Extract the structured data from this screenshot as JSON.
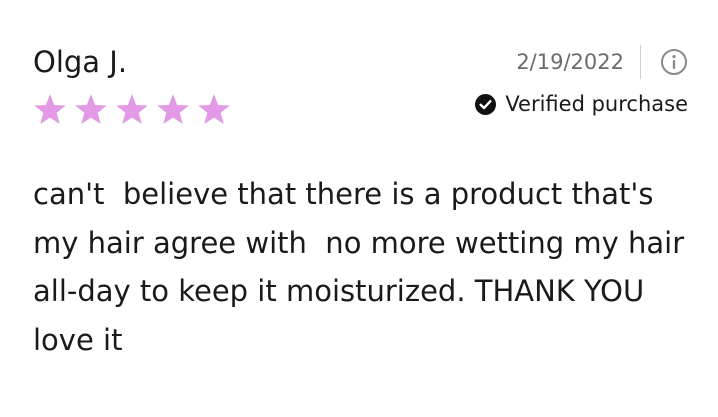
{
  "review": {
    "reviewer_name": "Olga J.",
    "rating": 5,
    "rating_max": 5,
    "star_color": "#e29ae6",
    "date": "2/19/2022",
    "verified_label": "Verified purchase",
    "text": "can't  believe that there is a product that's\nmy hair agree with  no more wetting my hair\nall-day to keep it moisturized. THANK YOU\nlove it"
  },
  "icons": {
    "info": "info-circle-icon",
    "verified": "check-circle-icon",
    "star": "star-icon"
  }
}
